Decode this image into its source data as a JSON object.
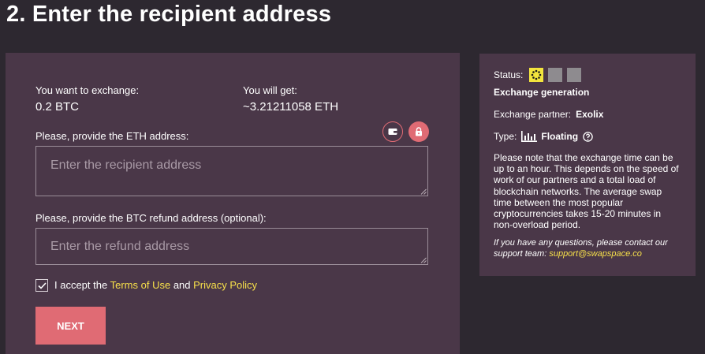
{
  "page": {
    "title": "2. Enter the recipient address"
  },
  "exchange": {
    "want_label": "You want to exchange:",
    "want_value": "0.2 BTC",
    "get_label": "You will get:",
    "get_value": "~3.21211058 ETH"
  },
  "form": {
    "eth_label": "Please, provide the ETH address:",
    "eth_placeholder": "Enter the recipient address",
    "refund_label": "Please, provide the BTC refund address (optional):",
    "refund_placeholder": "Enter the refund address",
    "accept_prefix": "I accept the",
    "terms_link": "Terms of Use",
    "accept_and": "and",
    "privacy_link": "Privacy Policy",
    "accepted": true,
    "next_label": "NEXT"
  },
  "icons": {
    "wallet": "wallet-icon",
    "lock": "lock-icon",
    "spinner": "spinner-icon",
    "bars": "bar-chart-icon",
    "help": "help-icon",
    "check": "check-icon"
  },
  "status_panel": {
    "status_label": "Status:",
    "status_step": "Exchange generation",
    "partner_label": "Exchange partner:",
    "partner_value": "Exolix",
    "type_label": "Type:",
    "type_value": "Floating",
    "note": "Please note that the exchange time can be up to an hour. This depends on the speed of work of our partners and a total load of blockchain networks. The average swap time between the most popular cryptocurrencies takes 15-20 minutes in non-overload period.",
    "contact_text": "If you have any questions, please contact our support team:",
    "contact_email": "support@swapspace.co"
  },
  "colors": {
    "background": "#2d2830",
    "card": "#4a3748",
    "accent": "#e06b74",
    "link": "#f7e04a",
    "status_active": "#f3e53d",
    "status_inactive": "#8e8b8f"
  }
}
